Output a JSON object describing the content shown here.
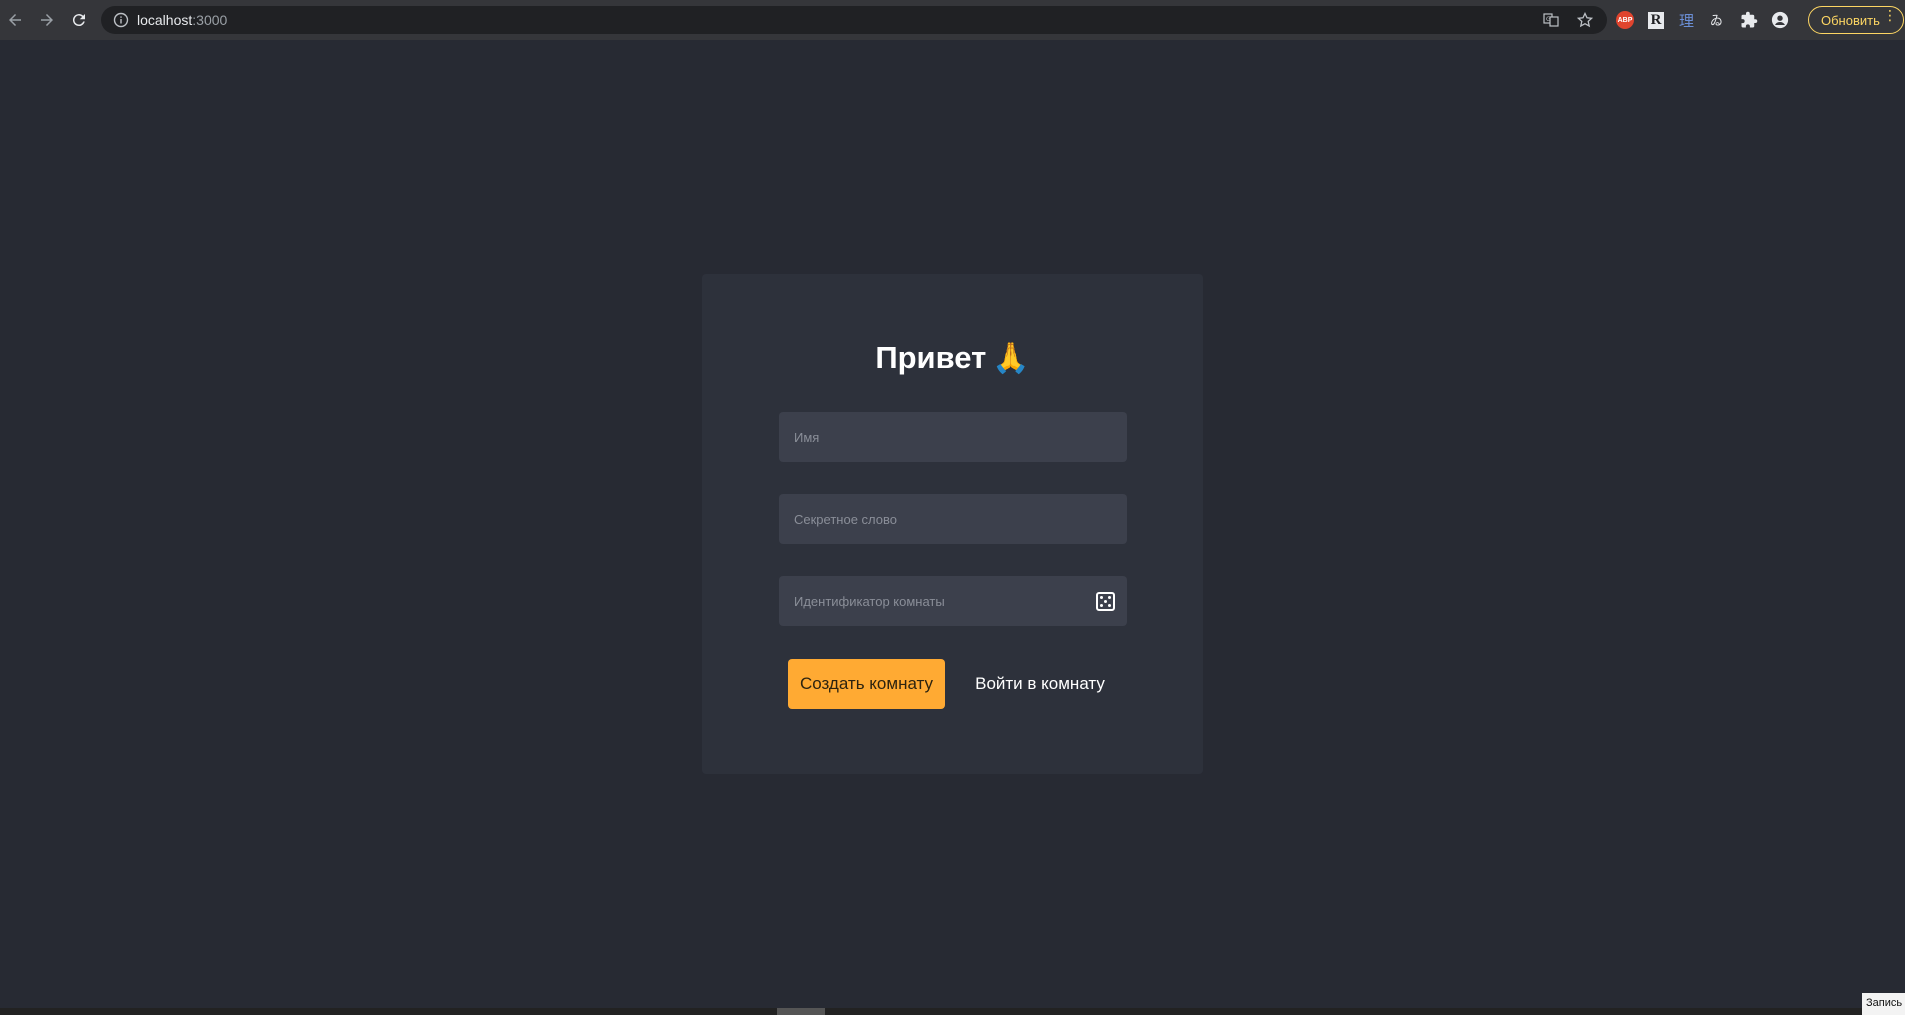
{
  "browser": {
    "url_host": "localhost",
    "url_port": ":3000",
    "update_label": "Обновить",
    "extensions": [
      "adblock-icon",
      "r-extension-icon",
      "translate-ext-icon",
      "yomichan-icon",
      "puzzle-icon",
      "profile-icon"
    ]
  },
  "login": {
    "title": "Привет",
    "title_emoji": "🙏",
    "name_placeholder": "Имя",
    "secret_placeholder": "Секретное слово",
    "room_placeholder": "Идентификатор комнаты",
    "create_label": "Создать комнату",
    "join_label": "Войти в комнату"
  },
  "overlay": {
    "record_label": "Запись"
  },
  "colors": {
    "page_bg": "#272a33",
    "card_bg": "#2d313b",
    "input_bg": "#3c404c",
    "accent": "#ffaa33"
  }
}
